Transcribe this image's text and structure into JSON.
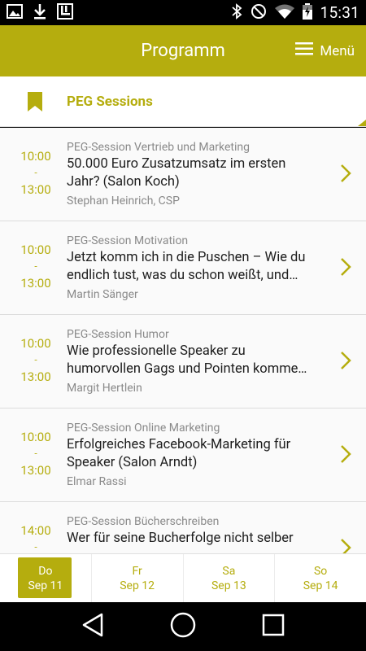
{
  "status_bar": {
    "time": "15:31",
    "icons_left": [
      "image-icon",
      "download-icon",
      "app-notification-icon"
    ],
    "icons_right": [
      "bluetooth-icon",
      "do-not-disturb-icon",
      "wifi-icon",
      "battery-charging-icon"
    ]
  },
  "app_bar": {
    "title": "Programm",
    "menu_label": "Menü",
    "menu_icon": "hamburger-icon"
  },
  "section": {
    "title": "PEG Sessions",
    "icon": "bookmark-icon"
  },
  "sessions": [
    {
      "start": "10:00",
      "dash": "-",
      "end": "13:00",
      "category": "PEG-Session Vertrieb und Marketing",
      "title_line1": "50.000 Euro Zusatzumsatz im ersten",
      "title_line2": "Jahr? (Salon Koch)",
      "speaker": "Stephan Heinrich, CSP"
    },
    {
      "start": "10:00",
      "dash": "-",
      "end": "13:00",
      "category": "PEG-Session Motivation",
      "title_line1": "Jetzt komm ich in die Puschen – Wie du",
      "title_line2": "endlich tust, was du schon weißt, und…",
      "speaker": "Martin Sänger"
    },
    {
      "start": "10:00",
      "dash": "-",
      "end": "13:00",
      "category": "PEG-Session Humor",
      "title_line1": "Wie professionelle Speaker zu",
      "title_line2": "humorvollen Gags und Pointen komme…",
      "speaker": "Margit Hertlein"
    },
    {
      "start": "10:00",
      "dash": "-",
      "end": "13:00",
      "category": "PEG-Session Online Marketing",
      "title_line1": "Erfolgreiches Facebook-Marketing für",
      "title_line2": "Speaker (Salon Arndt)",
      "speaker": "Elmar Rassi"
    },
    {
      "start": "14:00",
      "dash": "-",
      "end": "",
      "category": "PEG-Session Bücherschreiben",
      "title_line1": "Wer für seine Bucherfolge nicht selber",
      "title_line2": "",
      "speaker": ""
    }
  ],
  "day_tabs": [
    {
      "day": "Do",
      "date": "Sep 11",
      "active": true
    },
    {
      "day": "Fr",
      "date": "Sep 12",
      "active": false
    },
    {
      "day": "Sa",
      "date": "Sep 13",
      "active": false
    },
    {
      "day": "So",
      "date": "Sep 14",
      "active": false
    }
  ],
  "nav_bar": {
    "icons": [
      "back-icon",
      "home-icon",
      "recents-icon"
    ]
  },
  "colors": {
    "accent": "#b5ad0e",
    "background": "#fafafa",
    "text_primary": "#1e1e1e",
    "text_secondary": "#8a8a8a"
  }
}
